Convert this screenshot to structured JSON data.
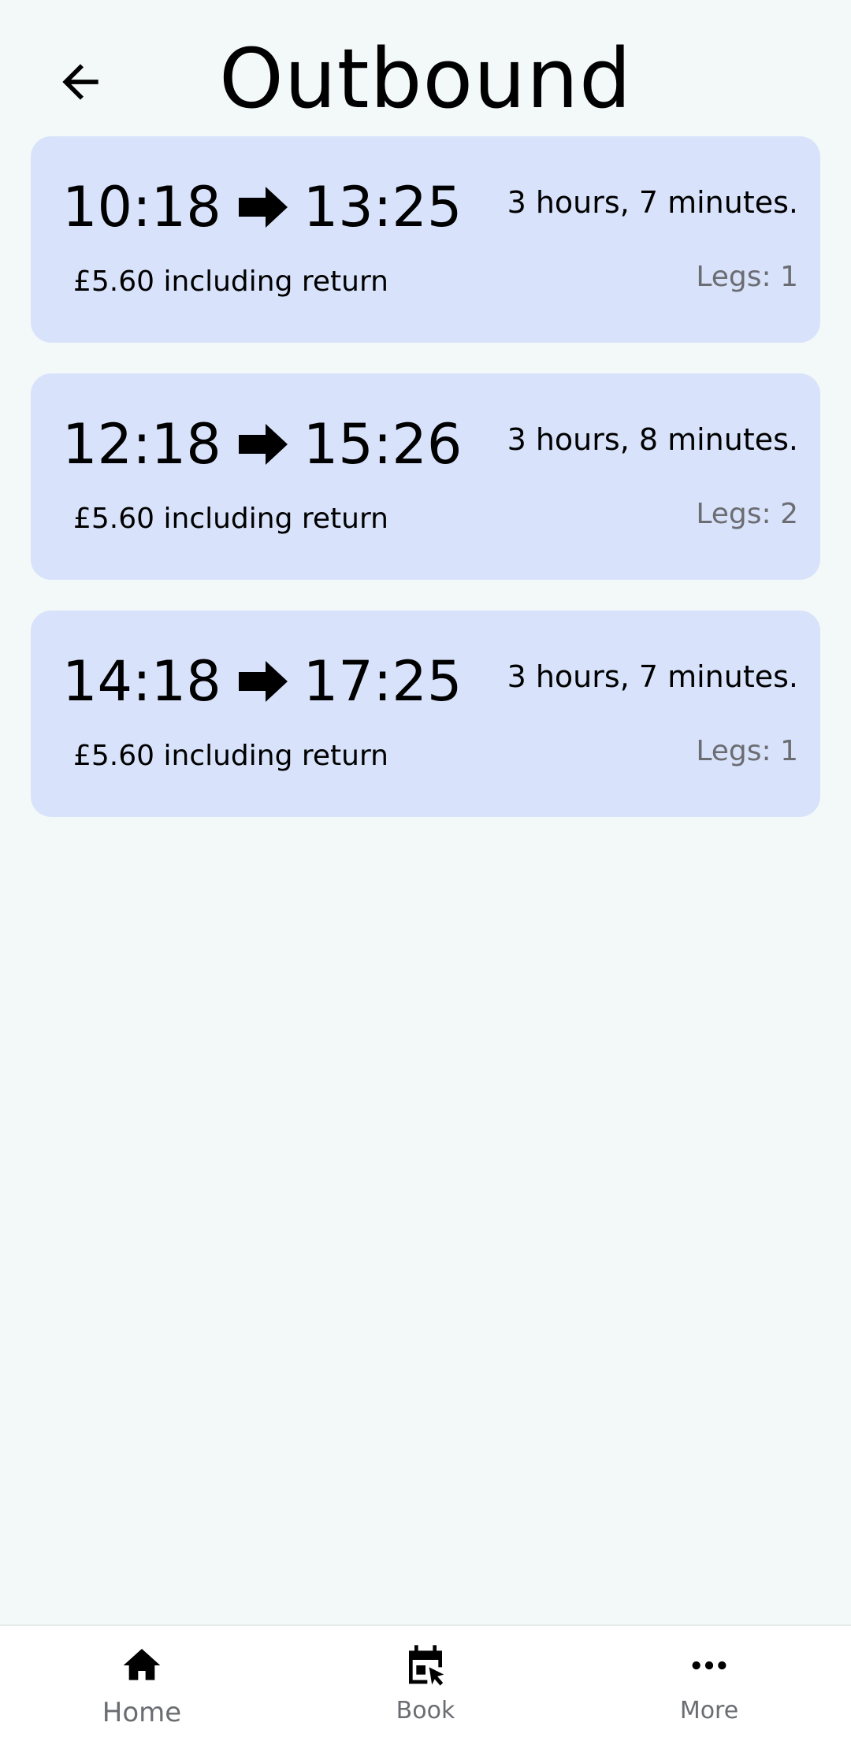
{
  "header": {
    "title": "Outbound",
    "back_icon": "arrow-left-icon"
  },
  "journeys": [
    {
      "depart": "10:18",
      "arrive": "13:25",
      "duration": "3 hours, 7 minutes.",
      "price": "£5.60 including return",
      "legs": "Legs: 1"
    },
    {
      "depart": "12:18",
      "arrive": "15:26",
      "duration": "3 hours, 8 minutes.",
      "price": "£5.60 including return",
      "legs": "Legs: 2"
    },
    {
      "depart": "14:18",
      "arrive": "17:25",
      "duration": "3 hours, 7 minutes.",
      "price": "£5.60 including return",
      "legs": "Legs: 1"
    }
  ],
  "bottom_nav": {
    "items": [
      {
        "label": "Home",
        "icon": "home-icon"
      },
      {
        "label": "Book",
        "icon": "calendar-click-icon"
      },
      {
        "label": "More",
        "icon": "more-horizontal-icon"
      }
    ]
  },
  "colors": {
    "background": "#f3f8f8",
    "card": "#d8e3fb",
    "muted_text": "#6b6d72",
    "nav_background": "#ffffff"
  }
}
